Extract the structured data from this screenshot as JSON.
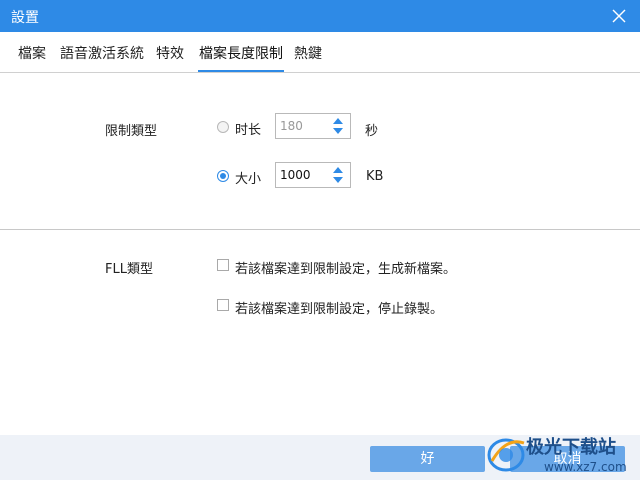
{
  "window": {
    "title": "設置",
    "close_icon": "close-icon"
  },
  "tabs": [
    {
      "label": "檔案",
      "active": false
    },
    {
      "label": "語音激活系統",
      "active": false
    },
    {
      "label": "特效",
      "active": false
    },
    {
      "label": "檔案長度限制",
      "active": true
    },
    {
      "label": "熱鍵",
      "active": false
    }
  ],
  "limit_type": {
    "label": "限制類型",
    "duration": {
      "label": "时长",
      "value": "180",
      "unit": "秒",
      "checked": false
    },
    "size": {
      "label": "大小",
      "value": "1000",
      "unit": "KB",
      "checked": true
    }
  },
  "fll_type": {
    "label": "FLL類型",
    "options": [
      {
        "label": "若該檔案達到限制設定，生成新檔案。",
        "checked": false
      },
      {
        "label": "若該檔案達到限制設定，停止錄製。",
        "checked": false
      }
    ]
  },
  "footer": {
    "ok_label": "好",
    "cancel_label": "取消"
  },
  "watermark": {
    "text": "极光下载站",
    "url": "www.xz7.com"
  },
  "colors": {
    "accent": "#2e8ae6",
    "button": "#69a7e8",
    "footer_bg": "#eef2f8"
  }
}
